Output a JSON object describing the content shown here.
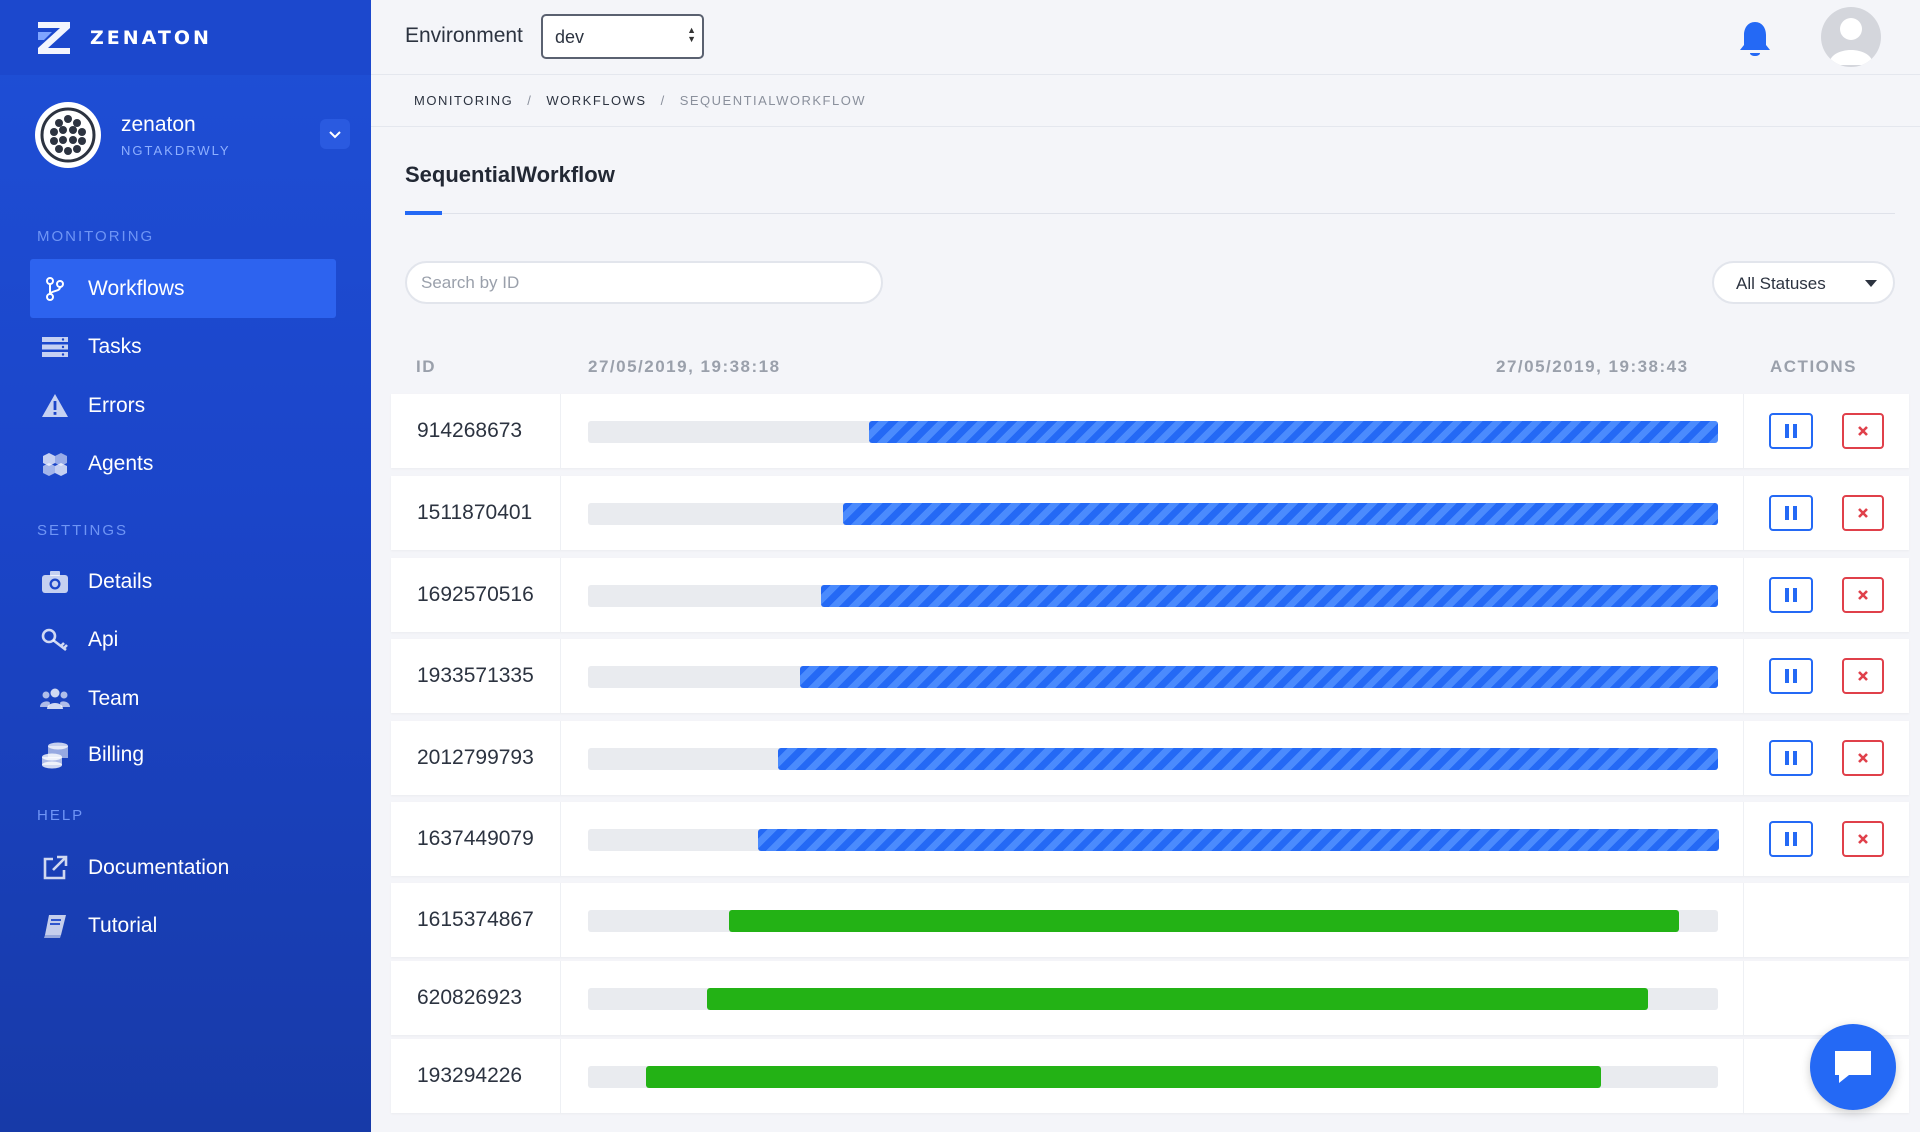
{
  "brand": {
    "name": "ZENATON"
  },
  "account": {
    "name": "zenaton",
    "id": "NGTAKDRWLY"
  },
  "sidebar": {
    "sections": [
      {
        "title": "MONITORING",
        "items": [
          {
            "label": "Workflows",
            "icon": "branch-icon",
            "active": true
          },
          {
            "label": "Tasks",
            "icon": "server-icon"
          },
          {
            "label": "Errors",
            "icon": "warning-icon"
          },
          {
            "label": "Agents",
            "icon": "cubes-icon"
          }
        ]
      },
      {
        "title": "SETTINGS",
        "items": [
          {
            "label": "Details",
            "icon": "camera-icon"
          },
          {
            "label": "Api",
            "icon": "key-icon"
          },
          {
            "label": "Team",
            "icon": "users-icon"
          },
          {
            "label": "Billing",
            "icon": "coins-icon"
          }
        ]
      },
      {
        "title": "HELP",
        "items": [
          {
            "label": "Documentation",
            "icon": "external-link-icon"
          },
          {
            "label": "Tutorial",
            "icon": "book-icon"
          }
        ]
      }
    ]
  },
  "header": {
    "env_label": "Environment",
    "env_value": "dev"
  },
  "breadcrumb": {
    "items": [
      "MONITORING",
      "WORKFLOWS",
      "SEQUENTIALWORKFLOW"
    ]
  },
  "page": {
    "title": "SequentialWorkflow"
  },
  "filters": {
    "search_placeholder": "Search by ID",
    "status_value": "All Statuses"
  },
  "table": {
    "col_id": "ID",
    "start_time": "27/05/2019, 19:38:18",
    "end_time": "27/05/2019, 19:38:43",
    "col_actions": "ACTIONS",
    "rows": [
      {
        "id": "914268673",
        "status": "running",
        "start": 0.249,
        "end": 1.0
      },
      {
        "id": "1511870401",
        "status": "running",
        "start": 0.226,
        "end": 1.0
      },
      {
        "id": "1692570516",
        "status": "running",
        "start": 0.206,
        "end": 1.0
      },
      {
        "id": "1933571335",
        "status": "running",
        "start": 0.188,
        "end": 1.0
      },
      {
        "id": "2012799793",
        "status": "running",
        "start": 0.168,
        "end": 1.0
      },
      {
        "id": "1637449079",
        "status": "running",
        "start": 0.15,
        "end": 1.0
      },
      {
        "id": "1615374867",
        "status": "completed",
        "start": 0.125,
        "end": 0.966
      },
      {
        "id": "620826923",
        "status": "completed",
        "start": 0.105,
        "end": 0.938
      },
      {
        "id": "193294226",
        "status": "completed",
        "start": 0.051,
        "end": 0.896
      }
    ]
  },
  "colors": {
    "accent": "#2469f5",
    "running": "#2469f5",
    "completed": "#23b215",
    "danger": "#e0404a",
    "sidebar": "#1b45c9"
  }
}
